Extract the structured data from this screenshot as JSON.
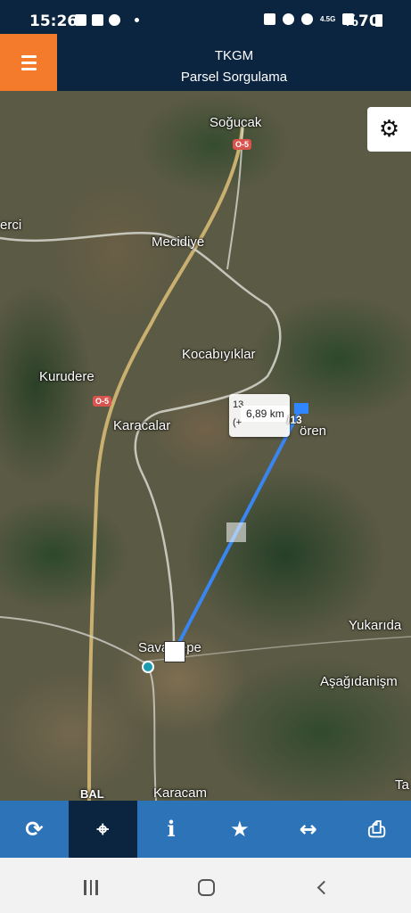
{
  "status_bar": {
    "time": "15:26",
    "network": "4.5G",
    "battery": "%70"
  },
  "header": {
    "title": "TKGM",
    "subtitle": "Parsel Sorgulama"
  },
  "map": {
    "places": {
      "sogucak": "Soğucak",
      "erci": "erci",
      "mecidiye": "Mecidiye",
      "kocabiyiklar": "Kocabıyıklar",
      "kurudere": "Kurudere",
      "karacalar": "Karacalar",
      "oren": "ören",
      "yukarida": "Yukarıda",
      "asagidanism": "Aşağıdanişm",
      "savastepe": "Savaştepe",
      "karacam": "Karacam",
      "ta": "Ta",
      "bal": "BAL"
    },
    "road_badges": [
      "O-5",
      "O-5"
    ],
    "measurement": "6,89 km",
    "tooltip_fragments": [
      "13",
      "(+"
    ],
    "parcel_label": "/13"
  },
  "toolbar": {
    "buttons": [
      {
        "icon": "refresh-icon",
        "glyph": "⟳"
      },
      {
        "icon": "crosshair-icon",
        "glyph": "⌖"
      },
      {
        "icon": "info-icon",
        "glyph": "i"
      },
      {
        "icon": "star-icon",
        "glyph": "★"
      },
      {
        "icon": "measure-icon",
        "glyph": "↔"
      },
      {
        "icon": "print-icon",
        "glyph": "⎙"
      }
    ],
    "active_index": 1
  },
  "colors": {
    "header_bg": "#0b2440",
    "menu_accent": "#f47b2c",
    "toolbar_bg": "#2d73b8",
    "toolbar_active": "#0b2440",
    "measure_line": "#3a86f0"
  }
}
